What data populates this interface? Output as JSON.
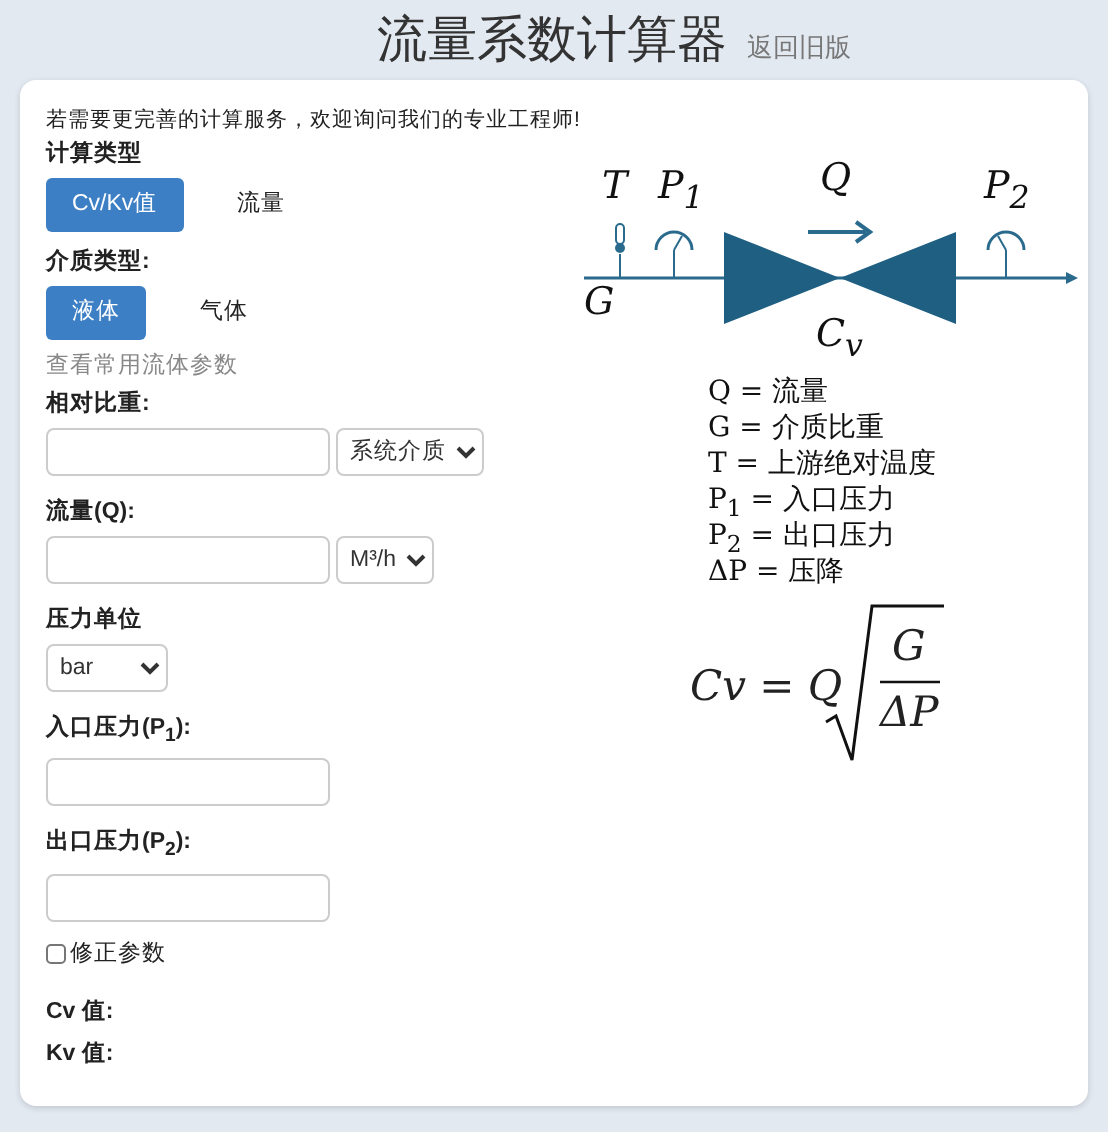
{
  "header": {
    "title": "流量系数计算器",
    "link": "返回旧版"
  },
  "notice": "若需要更完善的计算服务，欢迎询问我们的专业工程师!",
  "calc_type": {
    "label": "计算类型",
    "options": [
      {
        "label": "Cv/Kv值",
        "selected": true
      },
      {
        "label": "流量",
        "selected": false
      }
    ]
  },
  "medium_type": {
    "label": "介质类型:",
    "options": [
      {
        "label": "液体",
        "selected": true
      },
      {
        "label": "气体",
        "selected": false
      }
    ]
  },
  "fluid_link": "查看常用流体参数",
  "fields": [
    {
      "kind": "input_select",
      "label": "相对比重:",
      "select": "系统介质"
    },
    {
      "kind": "input_select",
      "label": "流量(Q):",
      "select": "M³/h"
    },
    {
      "kind": "select",
      "label": "压力单位",
      "select": "bar"
    },
    {
      "kind": "input",
      "label": "入口压力(P$_{1}$):"
    },
    {
      "kind": "input",
      "label": "出口压力(P$_{2}$):"
    }
  ],
  "correction": {
    "label": "修正参数",
    "checked": false
  },
  "results": [
    "Cv 值:",
    "Kv 值:"
  ],
  "diagram": {
    "symbols": {
      "temperature": "T",
      "inlet_pressure": "P$_{1}$",
      "flow": "Q",
      "outlet_pressure": "P$_{2}$",
      "gravity": "G",
      "coefficient": "C$_{v}$"
    },
    "legend": [
      "Q = 流量",
      "G = 介质比重",
      "T = 上游绝对温度",
      "P$_{1}$ = 入口压力",
      "P$_{2}$ = 出口压力",
      "ΔP = 压降"
    ],
    "formula": {
      "left": "Cv = Q",
      "numerator": "G",
      "denominator": "ΔP"
    }
  }
}
